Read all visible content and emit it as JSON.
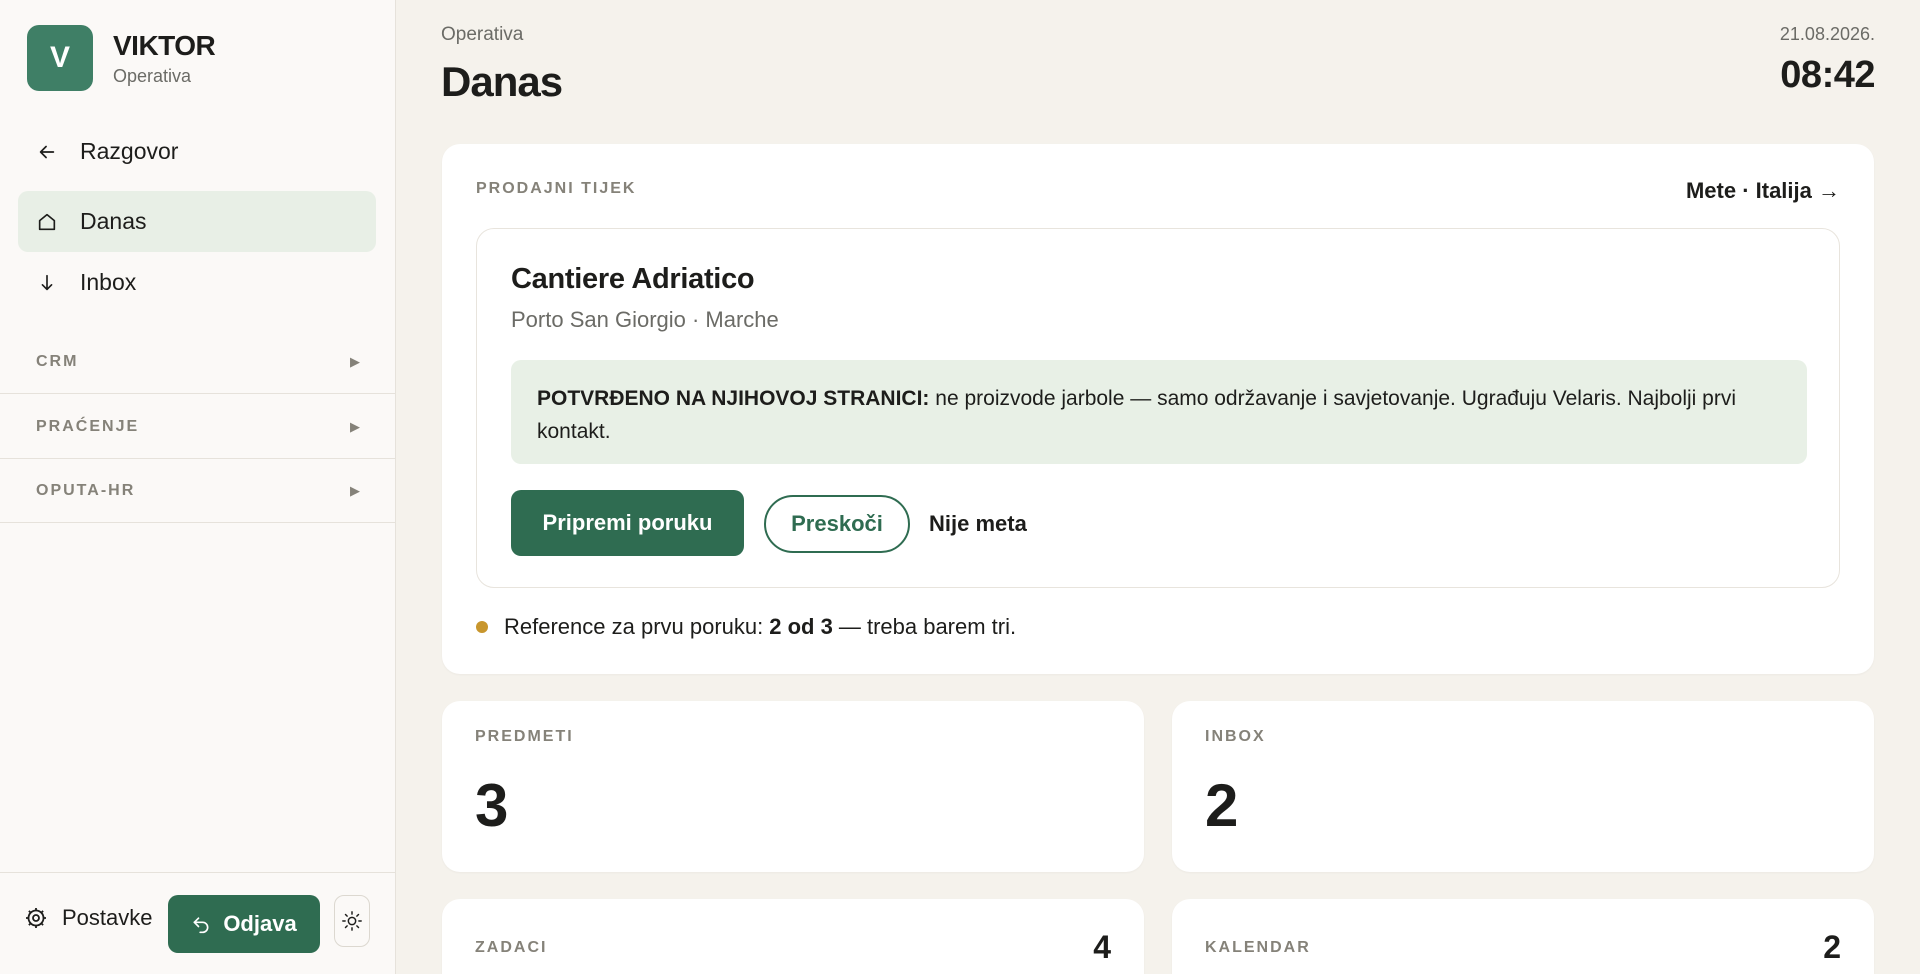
{
  "brand": {
    "initial": "V",
    "name": "VIKTOR",
    "subtitle": "Operativa"
  },
  "nav": [
    {
      "label": "Razgovor",
      "icon": "arrow-left-icon"
    },
    {
      "label": "Danas",
      "icon": "home-icon",
      "active": true
    },
    {
      "label": "Inbox",
      "icon": "arrow-down-icon"
    }
  ],
  "sections": [
    {
      "label": "CRM"
    },
    {
      "label": "PRAĆENJE"
    },
    {
      "label": "OPUTA-HR"
    }
  ],
  "footer": {
    "settings_label": "Postavke",
    "logout_label": "Odjava"
  },
  "header": {
    "breadcrumb": "Operativa",
    "title": "Danas",
    "date": "21.08.2026.",
    "time": "08:42"
  },
  "pipeline": {
    "label": "PRODAJNI TIJEK",
    "link": "Mete · Italija →",
    "lead": {
      "name": "Cantiere Adriatico",
      "location": "Porto San Giorgio · Marche",
      "note_bold": "POTVRĐENO NA NJIHOVOJ STRANICI:",
      "note_text": " ne proizvode jarbole — samo održavanje i savjetovanje. Ugrađuju Velaris. Najbolji prvi kontakt."
    },
    "actions": {
      "primary": "Pripremi poruku",
      "skip": "Preskoči",
      "reject": "Nije meta"
    },
    "reference": {
      "prefix": "Reference za prvu poruku:",
      "count": "2 od 3",
      "suffix": "— treba barem tri."
    }
  },
  "stats": [
    {
      "label": "PREDMETI",
      "value": "3"
    },
    {
      "label": "INBOX",
      "value": "2"
    }
  ],
  "mini": [
    {
      "label": "ZADACI",
      "count": "4"
    },
    {
      "label": "KALENDAR",
      "count": "2"
    }
  ],
  "colors": {
    "accent": "#2f6c51",
    "logo": "#3f7f66",
    "note_bg": "#e8f0e6",
    "dot": "#c8962d",
    "background": "#f5f2ec"
  }
}
